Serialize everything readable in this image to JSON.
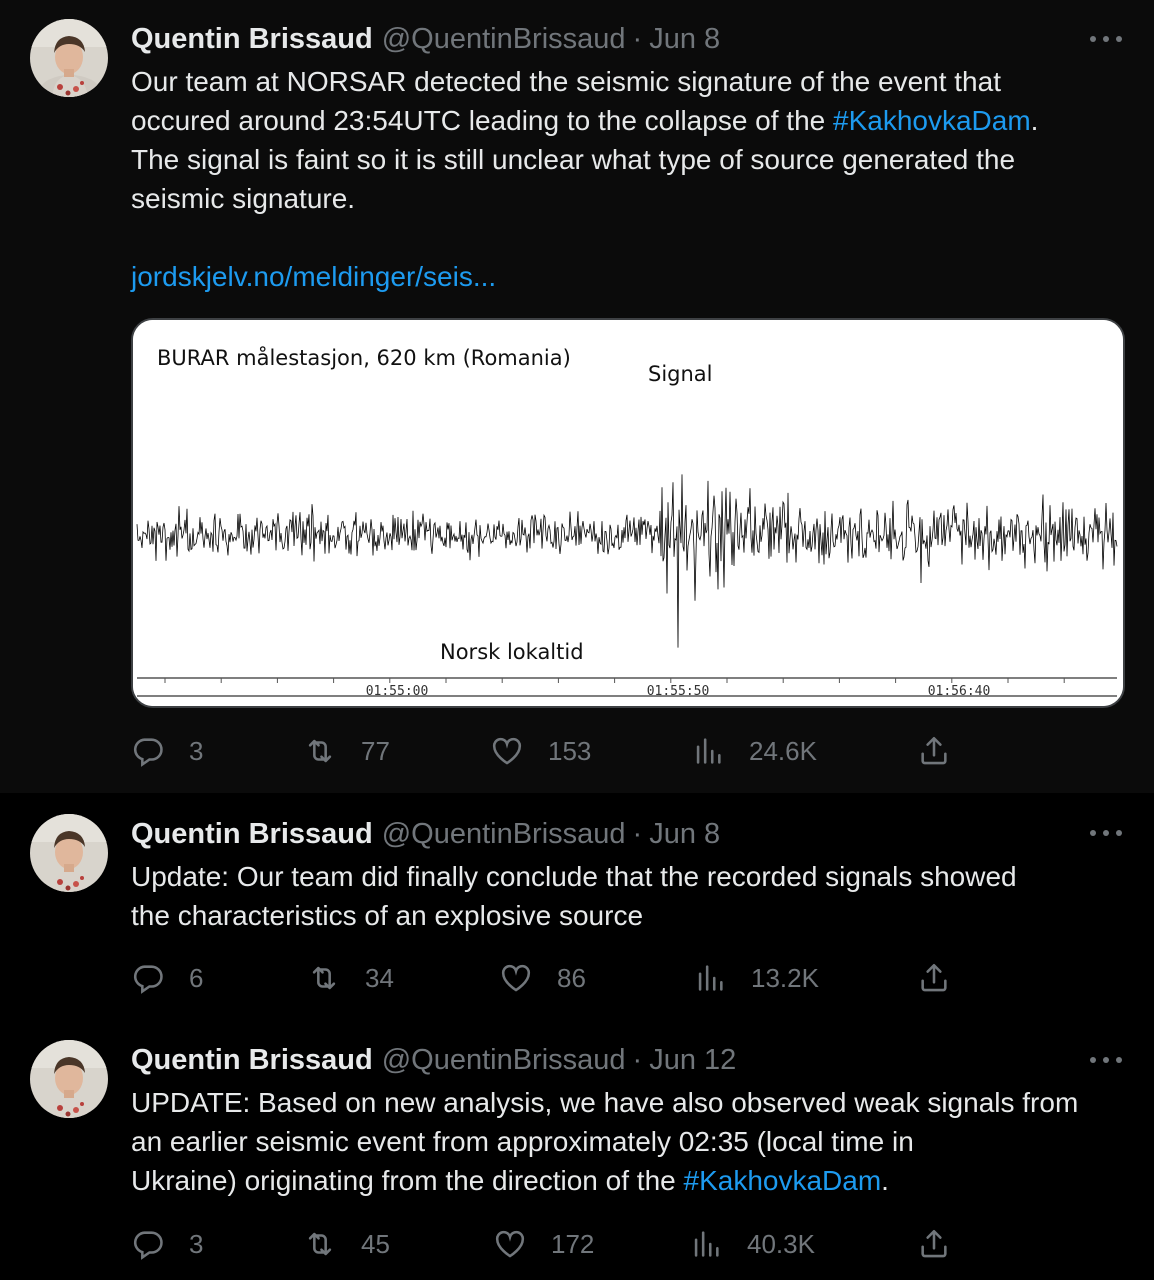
{
  "tweets": [
    {
      "author": {
        "name": "Quentin Brissaud",
        "handle": "@QuentinBrissaud"
      },
      "separator": "·",
      "date": "Jun 8",
      "text": {
        "line1": "Our team at NORSAR detected the seismic signature of the event that",
        "line2_pre": "occured around 23:54UTC leading to the collapse of the ",
        "line2_hashtag": "#KakhovkaDam",
        "line2_post": ".",
        "line3": "The signal is faint so it is still unclear what type of source generated the",
        "line4": "seismic signature.",
        "link": "jordskjelv.no/meldinger/seis..."
      },
      "media": {
        "title": "BURAR målestasjon, 620 km (Romania)",
        "signal_label": "Signal",
        "time_label": "Norsk lokaltid",
        "ticks": [
          "01:55:00",
          "01:55:50",
          "01:56:40"
        ]
      },
      "stats": {
        "replies": "3",
        "retweets": "77",
        "likes": "153",
        "views": "24.6K"
      }
    },
    {
      "author": {
        "name": "Quentin Brissaud",
        "handle": "@QuentinBrissaud"
      },
      "separator": "·",
      "date": "Jun 8",
      "text": {
        "line1": "Update: Our team did finally conclude that the recorded signals showed",
        "line2": "the characteristics of an explosive source"
      },
      "stats": {
        "replies": "6",
        "retweets": "34",
        "likes": "86",
        "views": "13.2K"
      }
    },
    {
      "author": {
        "name": "Quentin Brissaud",
        "handle": "@QuentinBrissaud"
      },
      "separator": "·",
      "date": "Jun 12",
      "text": {
        "line1": "UPDATE: Based on new analysis, we have also observed weak signals from",
        "line2": "an earlier seismic event from approximately 02:35 (local time in",
        "line3_pre": "Ukraine) originating from the direction of the ",
        "line3_hashtag": "#KakhovkaDam",
        "line3_post": "."
      },
      "stats": {
        "replies": "3",
        "retweets": "45",
        "likes": "172",
        "views": "40.3K"
      }
    }
  ],
  "colors": {
    "background": "#000000",
    "text": "#e7e9ea",
    "secondary": "#71767b",
    "accent": "#1d9bf0",
    "thread_line": "#3e4144"
  },
  "icons": [
    "more-icon",
    "reply-icon",
    "retweet-icon",
    "like-icon",
    "views-icon",
    "share-icon"
  ]
}
